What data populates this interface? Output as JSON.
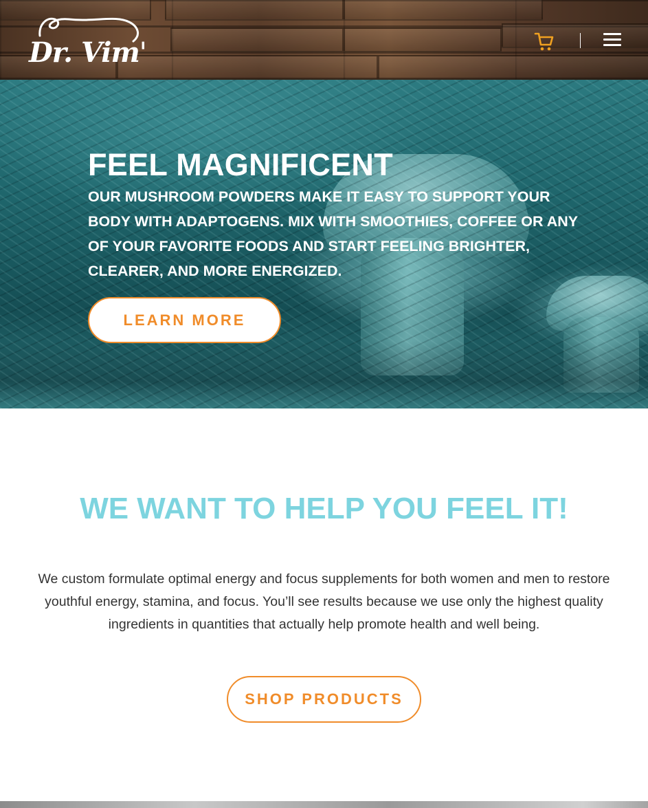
{
  "header": {
    "logo_text": "Dr. Vim's",
    "cart_icon": "cart-icon",
    "menu_icon": "hamburger-menu-icon",
    "accent_color": "#f0a020"
  },
  "hero": {
    "title": "FEEL MAGNIFICENT",
    "subtitle": "OUR MUSHROOM POWDERS MAKE IT EASY TO SUPPORT YOUR BODY WITH ADAPTOGENS. MIX WITH SMOOTHIES, COFFEE OR ANY OF YOUR FAVORITE FOODS AND START FEELING BRIGHTER, CLEARER, AND MORE ENERGIZED.",
    "button_label": "LEARN MORE"
  },
  "intro": {
    "headline": "WE WANT TO HELP YOU FEEL IT!",
    "body": "We custom formulate optimal energy and focus supplements for both women and men to restore youthful energy, stamina, and focus. You’ll see results because we use only the highest quality ingredients in quantities that actually help promote health and well being.",
    "button_label": "SHOP PRODUCTS"
  },
  "colors": {
    "headline": "#7dd4df",
    "button_accent": "#f08c2a"
  }
}
